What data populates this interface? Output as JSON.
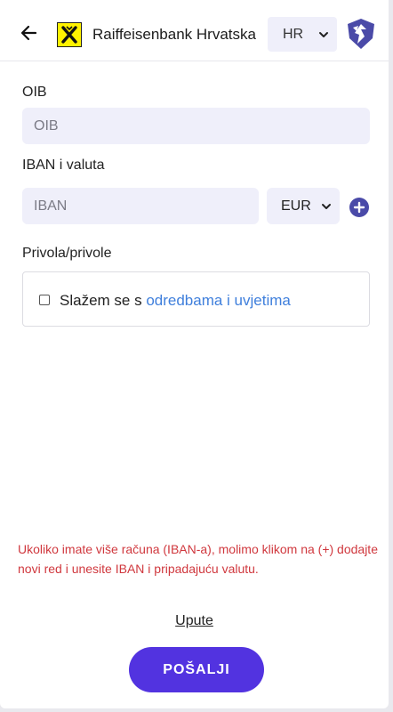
{
  "header": {
    "back_icon": "arrow-left-icon",
    "bank_logo_icon": "raiffeisen-logo-icon",
    "bank_name": "Raiffeisenbank Hrvatska",
    "language": {
      "selected": "HR"
    },
    "brand_icon": "shield-logo-icon"
  },
  "form": {
    "oib": {
      "label": "OIB",
      "placeholder": "OIB"
    },
    "iban": {
      "label": "IBAN i valuta",
      "placeholder": "IBAN",
      "currency": "EUR",
      "add_icon": "plus-circle-icon"
    },
    "consent": {
      "label": "Privola/privole",
      "text": "Slažem se s ",
      "link_text": "odredbama i uvjetima",
      "checked": false
    }
  },
  "notice": "Ukoliko imate više računa (IBAN-a), molimo klikom na (+) dodajte novi red i unesite IBAN i pripadajuću valutu.",
  "help_link": "Upute",
  "submit_label": "POŠALJI",
  "colors": {
    "accent": "#5233e0",
    "input_bg": "#efeffa",
    "link": "#3f7fdc",
    "notice": "#d0383e",
    "brand_icon": "#4a4aa8"
  }
}
